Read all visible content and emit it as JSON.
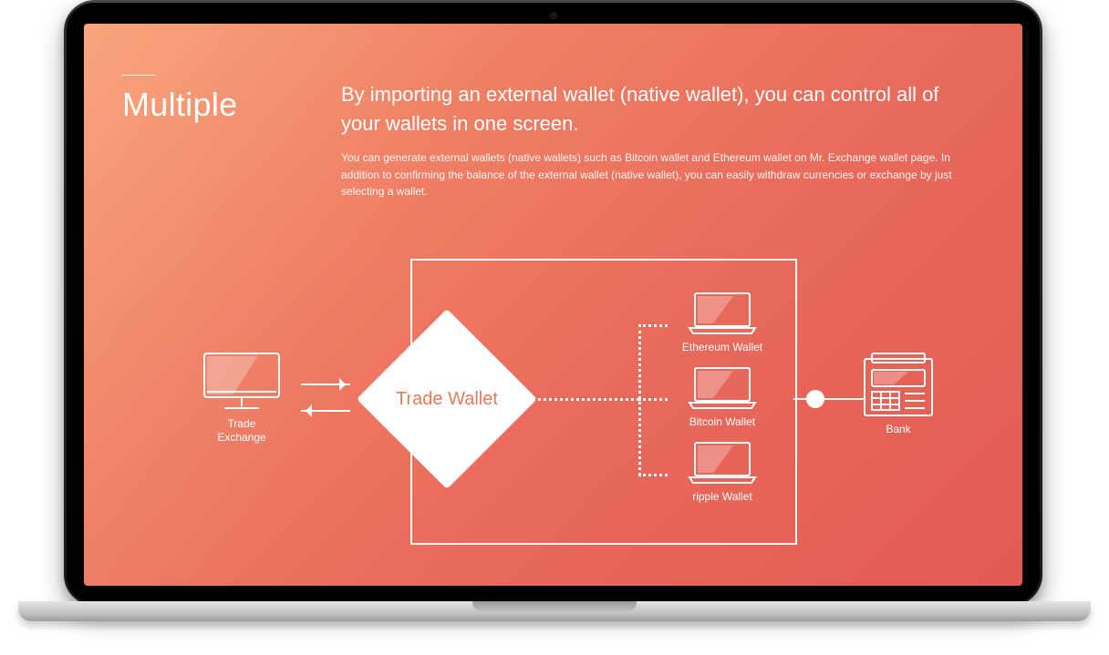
{
  "title": "Multiple",
  "lead": "By importing an external wallet (native wallet), you can control all of your wallets in one screen.",
  "body": "You can generate external wallets (native wallets) such as Bitcoin wallet and Ethereum wallet on Mr. Exchange wallet page. In addition to confirming the balance of the external wallet (native wallet), you can easily withdraw currencies or exchange by just selecting a wallet.",
  "diagram": {
    "trade_exchange": "Trade\nExchange",
    "trade_wallet": "Trade\nWallet",
    "wallets": [
      "Ethereum Wallet",
      "Bitcoin Wallet",
      "ripple Wallet"
    ],
    "bank": "Bank"
  }
}
